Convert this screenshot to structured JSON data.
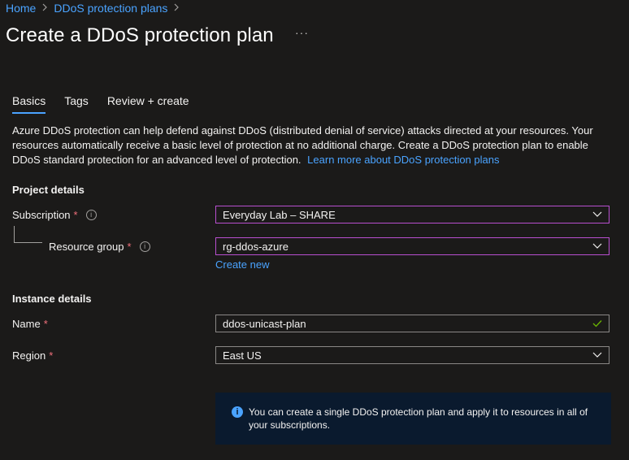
{
  "breadcrumb": {
    "items": [
      "Home",
      "DDoS protection plans"
    ],
    "separator": ">"
  },
  "page": {
    "title": "Create a DDoS protection plan",
    "more": "···"
  },
  "tabs": [
    {
      "label": "Basics",
      "active": true
    },
    {
      "label": "Tags"
    },
    {
      "label": "Review + create"
    }
  ],
  "description": {
    "text": "Azure DDoS protection can help defend against DDoS (distributed denial of service) attacks directed at your resources. Your resources automatically receive a basic level of protection at no additional charge. Create a DDoS protection plan to enable DDoS standard protection for an advanced level of protection.",
    "link": "Learn more about DDoS protection plans"
  },
  "project": {
    "heading": "Project details",
    "subscription": {
      "label": "Subscription",
      "required": "*",
      "value": "Everyday Lab – SHARE"
    },
    "resource_group": {
      "label": "Resource group",
      "required": "*",
      "value": "rg-ddos-azure",
      "create_new": "Create new"
    }
  },
  "instance": {
    "heading": "Instance details",
    "name": {
      "label": "Name",
      "required": "*",
      "value": "ddos-unicast-plan"
    },
    "region": {
      "label": "Region",
      "required": "*",
      "value": "East US"
    }
  },
  "info_box": {
    "icon": "i",
    "text": "You can create a single DDoS protection plan and apply it to resources in all of your subscriptions."
  },
  "colors": {
    "accent": "#4aa3ff",
    "required": "#f1707b",
    "focus_border": "#b84fcf",
    "valid": "#6bb700"
  }
}
